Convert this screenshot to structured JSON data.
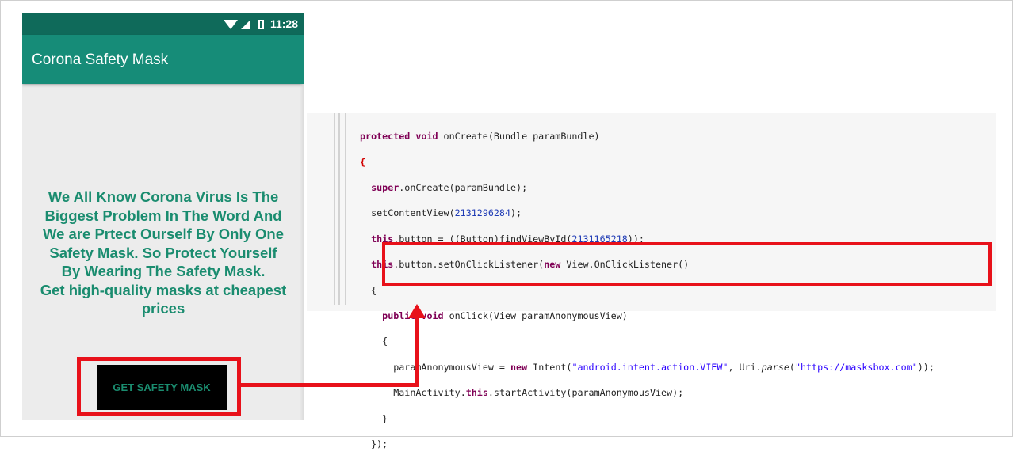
{
  "phone": {
    "status_time": "11:28",
    "app_title": "Corona Safety Mask",
    "message_lines": [
      "We All Know Corona Virus Is The",
      "Biggest Problem In The Word And",
      "We are Prtect Ourself By Only One",
      "Safety Mask. So Protect Yourself",
      "By Wearing The Safety Mask.",
      "Get high-quality masks at cheapest",
      "prices"
    ],
    "button_label": "GET SAFETY MASK"
  },
  "code": {
    "l1_kw": "protected void",
    "l1_rest": " onCreate(Bundle paramBundle)",
    "l2_brace": "{",
    "l3_kw": "super",
    "l3_rest": ".onCreate(paramBundle);",
    "l4_a": "setContentView(",
    "l4_num": "2131296284",
    "l4_b": ");",
    "l5_kw": "this",
    "l5_a": ".button = ((Button)findViewById(",
    "l5_num": "2131165218",
    "l5_b": "));",
    "l6_kw1": "this",
    "l6_a": ".button.setOnClickListener(",
    "l6_kw2": "new",
    "l6_b": " View.OnClickListener()",
    "l7": "{",
    "l8_kw": "public void",
    "l8_rest": " onClick(View paramAnonymousView)",
    "l9": "{",
    "l10_a": "paramAnonymousView = ",
    "l10_kw": "new",
    "l10_b": " Intent(",
    "l10_str1": "\"android.intent.action.VIEW\"",
    "l10_c": ", Uri.",
    "l10_parse": "parse",
    "l10_d": "(",
    "l10_str2": "\"https://masksbox.com\"",
    "l10_e": "));",
    "l11_ul": "MainActivity",
    "l11_a": ".",
    "l11_kw": "this",
    "l11_b": ".startActivity(paramAnonymousView);",
    "l12": "}",
    "l13": "});"
  },
  "colors": {
    "status_bar": "#0f6a5a",
    "app_bar": "#168c78",
    "message_text": "#1a8c6f",
    "highlight": "#e8111a"
  }
}
